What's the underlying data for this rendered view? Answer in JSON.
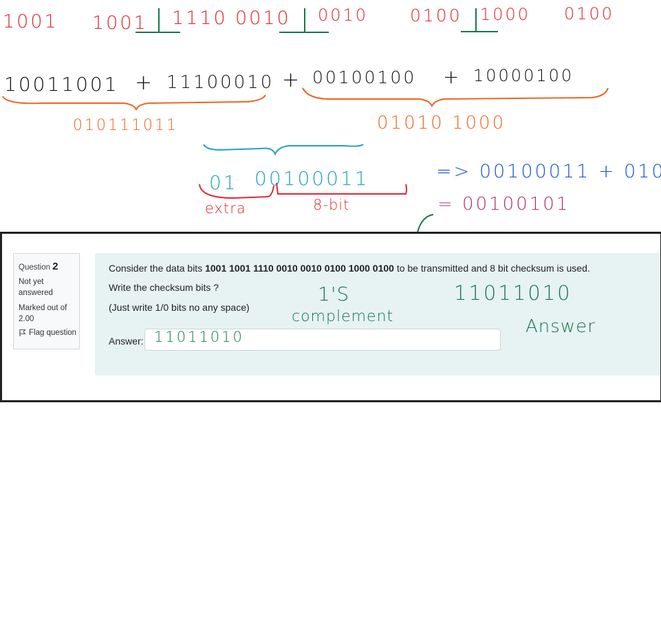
{
  "annotations": {
    "row1": [
      "1001",
      "1001",
      "1110",
      "0010",
      "0010",
      "0100",
      "1000",
      "0100"
    ],
    "row2": {
      "group1": "10011001",
      "plus1": "+",
      "group2": "11100010",
      "plus2": "+",
      "group3": "00100100",
      "plus3": "+",
      "group4": "10000100"
    },
    "sum1": "010111011",
    "sum2": "01010 1000",
    "total_extra": "01",
    "total_bits": "00100011",
    "extra_label": "extra",
    "bits_label": "8-bit",
    "wrap_text": "=> 00100011 + 010",
    "result_text": "= 00100101",
    "complement_label": "1'S",
    "complement_label2": "complement",
    "boxed_answer": "11011010",
    "answer_label": "Answer",
    "handwritten_input": "11011010"
  },
  "quiz": {
    "question_word": "Question",
    "question_number": "2",
    "status": "Not yet answered",
    "marks": "Marked out of 2.00",
    "flag_label": "Flag question",
    "text_before": "Consider the data bits ",
    "data_bits": "1001 1001 1110 0010 0010 0100 1000 0100",
    "text_after": " to be transmitted and 8 bit checksum is used.",
    "line2": "Write the checksum bits ?",
    "line3": "(Just write 1/0 bits no any space)",
    "answer_label": "Answer:",
    "answer_value": ""
  },
  "colors": {
    "red": "#e0282f",
    "orange": "#f0641e",
    "teal": "#1fa3c0",
    "blue": "#1b55d6",
    "purple": "#b02a70",
    "green": "#13784a",
    "panel": "#e7f2f3"
  }
}
